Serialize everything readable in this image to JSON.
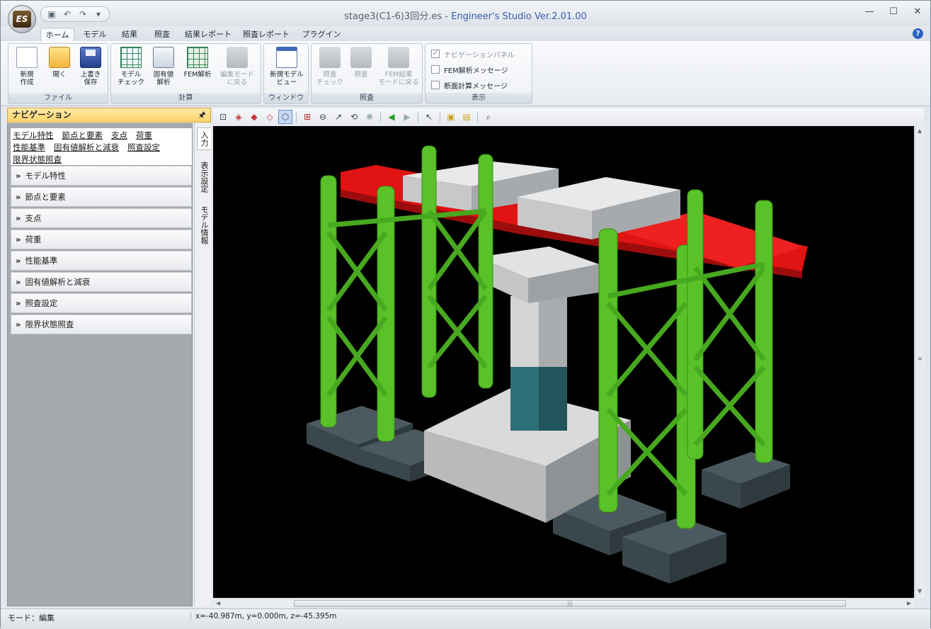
{
  "window": {
    "file_title": "stage3(C1-6)3回分.es",
    "title_separator": " - ",
    "app_name": "Engineer's Studio Ver.2.01.00",
    "logo_text": "ES"
  },
  "tabs": [
    "ホーム",
    "モデル",
    "結果",
    "照査",
    "結果レポート",
    "照査レポート",
    "プラグイン"
  ],
  "ribbon": {
    "file_group": {
      "label": "ファイル",
      "new": "新規\n作成",
      "open": "開く",
      "overwrite": "上書き\n保存"
    },
    "calc_group": {
      "label": "計算",
      "model_check": "モデル\nチェック",
      "eigen": "固有値\n解析",
      "fem": "FEM解析",
      "edit_mode": "編集モード\nに戻る"
    },
    "window_group": {
      "label": "ウィンドウ",
      "new_view": "新規モデル\nビュー"
    },
    "check_group": {
      "label": "照査",
      "check_check": "照査\nチェック",
      "check": "照査",
      "fem_back": "FEM結果\nモードに戻る"
    },
    "display_group": {
      "label": "表示",
      "nav_panel": "ナビゲーションパネル",
      "fem_msg": "FEM解析メッセージ",
      "section_msg": "断面計算メッセージ"
    }
  },
  "navigation": {
    "title": "ナビゲーション",
    "pin": "┃",
    "links": [
      "モデル特性",
      "節点と要素",
      "支点",
      "荷重",
      "性能基準",
      "固有値解析と減衰",
      "照査設定",
      "限界状態照査"
    ],
    "items": [
      "モデル特性",
      "節点と要素",
      "支点",
      "荷重",
      "性能基準",
      "固有値解析と減衰",
      "照査設定",
      "限界状態照査"
    ],
    "side_tabs": [
      "入力",
      "表示設定",
      "モデル情報"
    ]
  },
  "status": {
    "mode": "モード：編集",
    "coords": "x=-40.987m, y=0.000m, z=-45.395m"
  },
  "colors": {
    "steel": "#58c228",
    "girder": "#e01010",
    "concrete": "#c9cbcd",
    "footing": "#3c4a4f",
    "pier_base": "#2c6a72"
  }
}
